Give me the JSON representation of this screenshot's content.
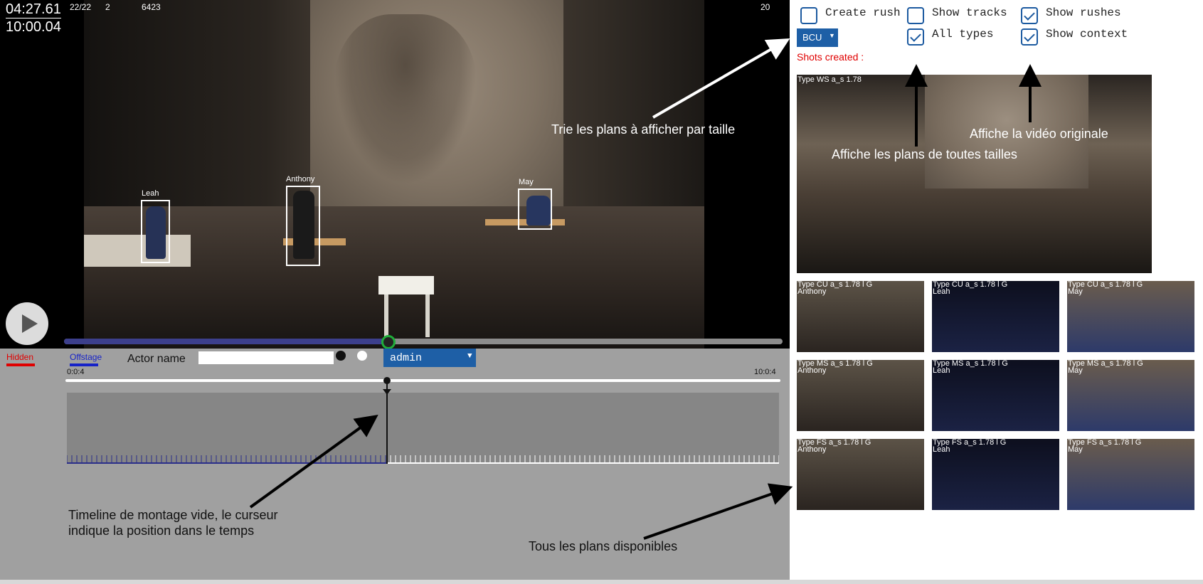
{
  "video": {
    "current_time": "04:27.61",
    "total_time": "10:00.04",
    "counter": "22/22",
    "index": "2",
    "frame": "6423",
    "fps": "20",
    "progress_fraction": 0.45,
    "actors": [
      {
        "name": "Leah"
      },
      {
        "name": "Anthony"
      },
      {
        "name": "May"
      }
    ],
    "annotation_sort": "Trie les plans à afficher par taille"
  },
  "editor": {
    "hidden_label": "Hidden",
    "offstage_label": "Offstage",
    "actor_name_label": "Actor name",
    "actor_name_value": "",
    "user_select": "admin",
    "time_start": "0:0:4",
    "time_end": "10:0:4",
    "cursor_fraction": 0.45,
    "annotation_timeline": [
      "Timeline de montage vide, le curseur",
      "indique la position dans le temps"
    ],
    "annotation_shots": "Tous les plans disponibles"
  },
  "right_panel": {
    "create_rush": {
      "label": "Create rush",
      "checked": false
    },
    "show_tracks": {
      "label": "Show tracks",
      "checked": false
    },
    "show_rushes": {
      "label": "Show rushes",
      "checked": true
    },
    "all_types": {
      "label": "All types",
      "checked": true
    },
    "show_context": {
      "label": "Show context",
      "checked": true
    },
    "size_select": "BCU",
    "shots_created": "Shots created :",
    "main_thumb_caption": "Type WS a_s 1.78",
    "annotation_all_sizes": "Affiche les plans de toutes tailles",
    "annotation_original": "Affiche la vidéo originale",
    "thumbs": [
      {
        "type": "Type CU a_s 1.78 l G",
        "actor": "Anthony"
      },
      {
        "type": "Type CU a_s 1.78 l G",
        "actor": "Leah"
      },
      {
        "type": "Type CU a_s 1.78 l G",
        "actor": "May"
      },
      {
        "type": "Type MS a_s 1.78 l G",
        "actor": "Anthony"
      },
      {
        "type": "Type MS a_s 1.78 l G",
        "actor": "Leah"
      },
      {
        "type": "Type MS a_s 1.78 l G",
        "actor": "May"
      },
      {
        "type": "Type FS a_s 1.78 l G",
        "actor": "Anthony"
      },
      {
        "type": "Type FS a_s 1.78 l G",
        "actor": "Leah"
      },
      {
        "type": "Type FS a_s 1.78 l G",
        "actor": "May"
      }
    ]
  },
  "colors": {
    "accent": "#1e5fa6",
    "hidden": "#e00000",
    "offstage": "#1622c8",
    "progress": "#3c3f8c",
    "knob_ring": "#1fae3a"
  }
}
